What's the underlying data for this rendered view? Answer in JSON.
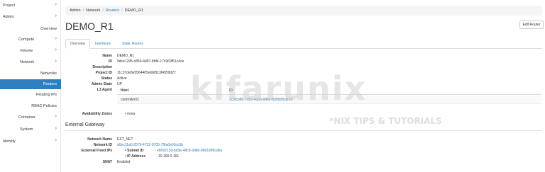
{
  "sidebar": {
    "items": [
      {
        "label": "Project",
        "chevron": true
      },
      {
        "label": "Admin",
        "chevron": true
      },
      {
        "label": "Overview",
        "chevron": false
      },
      {
        "label": "Compute",
        "chevron": true
      },
      {
        "label": "Volume",
        "chevron": true
      },
      {
        "label": "Network",
        "chevron": true
      },
      {
        "label": "Networks",
        "chevron": false
      },
      {
        "label": "Routers",
        "chevron": false,
        "active": true
      },
      {
        "label": "Floating IPs",
        "chevron": false
      },
      {
        "label": "RBAC Policies",
        "chevron": false
      },
      {
        "label": "Container",
        "chevron": true
      },
      {
        "label": "System",
        "chevron": true
      },
      {
        "label": "Identity",
        "chevron": true
      }
    ]
  },
  "breadcrumb": [
    "Admin",
    "Network",
    "Routers",
    "DEMO_R1"
  ],
  "page_title": "DEMO_R1",
  "edit_button": "Edit Router",
  "tabs": [
    "Overview",
    "Interfaces",
    "Static Routes"
  ],
  "overview": {
    "name_label": "Name",
    "name": "DEMO_R1",
    "id_label": "ID",
    "id": "9dce1295-c859-4d97-8bf4-17c969f51c4ce",
    "description_label": "Description",
    "description": "",
    "project_id_label": "Project ID",
    "project_id": "11c37de8e5564405ebbf913f4959d27",
    "status_label": "Status",
    "status": "Active",
    "admin_state_label": "Admin State",
    "admin_state": "UP",
    "l3_agent_label": "L3 Agent",
    "agent_headers": [
      "Host",
      "ID"
    ],
    "agent_host": "controller01",
    "agent_id": "3c5fcb85-7d89-4a56-b8f8-4b2fd2fcde56",
    "availability_zones_label": "Availability Zones",
    "availability_zone": "nova"
  },
  "external_gateway": {
    "title": "External Gateway",
    "network_name_label": "Network Name",
    "network_name": "EXT_NET",
    "network_id_label": "Network ID",
    "network_id": "a0ec11a0-2579-4732-9705-7f6a0e95cc6b",
    "fixed_ips_label": "External Fixed IPs",
    "subnet_id_label": "Subnet ID",
    "subnet_id": "e869213d-bd3e-48c8-9db0-06b16ff6cdba",
    "ip_label": "IP Address",
    "ip": "10.100.0.161",
    "snat_label": "SNAT",
    "snat": "Enabled"
  },
  "watermark": {
    "logo": "kifarunix",
    "tagline": "*NIX TIPS & TUTORIALS"
  },
  "colors": {
    "accent": "#2f7fc0",
    "link": "#337ab7"
  }
}
